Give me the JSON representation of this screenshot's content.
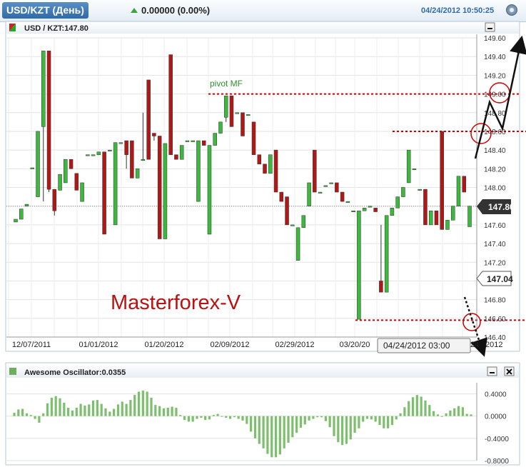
{
  "header": {
    "symbol_label": "USD/KZT (День)",
    "quote": "0.00000 (0.00%)",
    "datetime": "04/24/2012 10:50:25"
  },
  "price_panel": {
    "title": "USD / KZT:147.80",
    "watermark": "Masterforex-V",
    "pivot_label": "pivot MF",
    "last_price": "147.80",
    "marker_price": "147.04",
    "crosshair_label": "04/24/2012 03:00",
    "last_date_fragment": "24",
    "last_date_year": "2012"
  },
  "oscillator_panel": {
    "title": "Awesome Oscillator:0.0355"
  },
  "colors": {
    "bull": "#3cb83c",
    "bear": "#b01818",
    "annotation": "#cc0000",
    "watermark": "#bb1111",
    "oscillator": "#7cbf6c"
  },
  "chart_data": [
    {
      "type": "candlestick",
      "ylim": [
        146.4,
        149.6
      ],
      "y_ticks": [
        "149.60",
        "149.40",
        "149.20",
        "149.00",
        "148.80",
        "148.60",
        "148.40",
        "148.20",
        "148.00",
        "147.80",
        "147.60",
        "147.40",
        "147.20",
        "147.00",
        "146.80",
        "146.60",
        "146.40"
      ],
      "x_tick_labels": [
        "12/07/2011",
        "01/01/2012",
        "01/20/2012",
        "02/09/2012",
        "02/29/2012",
        "03/20/20"
      ],
      "candles": [
        [
          147.63,
          147.66,
          147.63,
          147.66
        ],
        [
          147.66,
          147.77,
          147.66,
          147.77
        ],
        [
          147.8,
          147.82,
          147.8,
          147.82
        ],
        [
          148.2,
          148.21,
          148.2,
          148.21
        ],
        [
          147.9,
          148.6,
          147.9,
          148.6
        ],
        [
          148.65,
          149.46,
          147.85,
          149.46
        ],
        [
          149.46,
          149.46,
          147.95,
          147.98
        ],
        [
          147.98,
          147.98,
          147.7,
          147.75
        ],
        [
          147.97,
          148.14,
          147.97,
          148.14
        ],
        [
          148.05,
          148.3,
          148.05,
          148.3
        ],
        [
          148.3,
          148.2,
          148.2,
          148.2
        ],
        [
          148.15,
          148.12,
          148.05,
          147.97
        ],
        [
          147.85,
          148.05,
          147.85,
          148.05
        ],
        [
          148.35,
          148.35,
          148.35,
          148.35
        ],
        [
          148.35,
          148.35,
          148.35,
          148.35
        ],
        [
          148.35,
          148.38,
          148.35,
          148.38
        ],
        [
          148.38,
          148.38,
          147.5,
          147.5
        ],
        [
          148.4,
          148.4,
          148.4,
          148.4
        ],
        [
          147.6,
          148.48,
          147.6,
          148.48
        ],
        [
          148.48,
          148.48,
          148.48,
          148.48
        ],
        [
          148.5,
          148.35,
          148.2,
          148.35
        ],
        [
          148.5,
          148.5,
          148.1,
          148.1
        ],
        [
          148.1,
          148.2,
          148.1,
          148.2
        ],
        [
          148.3,
          148.8,
          148.3,
          148.3
        ],
        [
          149.15,
          149.15,
          148.3,
          148.3
        ],
        [
          148.58,
          148.58,
          148.5,
          148.55
        ],
        [
          148.55,
          148.55,
          147.45,
          147.45
        ],
        [
          147.45,
          148.47,
          147.45,
          148.47
        ],
        [
          149.42,
          149.42,
          148.35,
          148.35
        ],
        [
          148.35,
          148.35,
          148.3,
          148.3
        ],
        [
          148.3,
          148.45,
          148.3,
          148.45
        ],
        [
          148.5,
          148.5,
          148.5,
          148.5
        ],
        [
          148.5,
          148.5,
          148.5,
          148.5
        ],
        [
          147.85,
          148.5,
          147.85,
          148.5
        ],
        [
          148.5,
          148.5,
          148.45,
          148.45
        ],
        [
          147.5,
          148.45,
          147.5,
          148.45
        ],
        [
          148.45,
          148.58,
          148.45,
          148.58
        ],
        [
          148.58,
          148.7,
          148.58,
          148.7
        ],
        [
          148.75,
          148.98,
          148.7,
          148.98
        ],
        [
          148.98,
          148.98,
          148.65,
          148.65
        ],
        [
          148.8,
          148.8,
          148.8,
          148.8
        ],
        [
          148.8,
          148.8,
          148.55,
          148.55
        ],
        [
          148.78,
          148.78,
          148.78,
          148.78
        ],
        [
          148.7,
          148.7,
          148.35,
          148.35
        ],
        [
          148.35,
          148.35,
          148.25,
          148.25
        ],
        [
          148.25,
          148.25,
          148.15,
          148.15
        ],
        [
          148.15,
          148.35,
          148.15,
          148.35
        ],
        [
          148.4,
          148.4,
          147.95,
          147.95
        ],
        [
          147.95,
          147.95,
          147.85,
          147.85
        ],
        [
          147.9,
          147.9,
          147.6,
          147.6
        ],
        [
          147.6,
          147.6,
          147.6,
          147.6
        ],
        [
          147.22,
          147.57,
          147.22,
          147.57
        ],
        [
          147.57,
          147.7,
          147.57,
          147.7
        ],
        [
          147.8,
          148.05,
          147.8,
          148.05
        ],
        [
          148.4,
          148.4,
          147.95,
          147.95
        ],
        [
          147.95,
          147.95,
          147.95,
          147.95
        ],
        [
          148.02,
          148.02,
          148.02,
          148.02
        ],
        [
          148.05,
          148.05,
          148.05,
          148.05
        ],
        [
          148.05,
          148.05,
          147.95,
          147.95
        ],
        [
          147.95,
          147.95,
          147.85,
          147.85
        ],
        [
          147.85,
          147.85,
          147.85,
          147.85
        ],
        [
          147.75,
          147.75,
          147.75,
          147.75
        ],
        [
          146.59,
          147.75,
          146.59,
          147.75
        ],
        [
          147.75,
          147.78,
          147.75,
          147.78
        ],
        [
          147.8,
          147.8,
          147.8,
          147.8
        ],
        [
          147.78,
          147.78,
          147.74,
          147.74
        ],
        [
          147.0,
          147.6,
          146.88,
          146.88
        ],
        [
          146.88,
          147.7,
          146.88,
          147.7
        ],
        [
          147.7,
          147.78,
          147.7,
          147.78
        ],
        [
          147.78,
          147.9,
          147.78,
          147.9
        ],
        [
          147.9,
          148.0,
          147.9,
          148.0
        ],
        [
          148.05,
          148.4,
          148.05,
          148.4
        ],
        [
          148.2,
          148.2,
          148.2,
          148.2
        ],
        [
          147.98,
          147.98,
          147.98,
          147.98
        ],
        [
          147.98,
          147.98,
          147.6,
          147.6
        ],
        [
          147.6,
          147.75,
          147.6,
          147.75
        ],
        [
          147.75,
          147.75,
          147.6,
          147.6
        ],
        [
          148.6,
          148.6,
          147.55,
          147.55
        ],
        [
          147.55,
          147.65,
          147.55,
          147.65
        ],
        [
          147.65,
          147.8,
          147.65,
          147.8
        ],
        [
          147.8,
          148.12,
          147.8,
          148.12
        ],
        [
          148.12,
          148.12,
          147.95,
          147.95
        ],
        [
          147.58,
          147.8,
          147.58,
          147.8
        ]
      ],
      "annotations": [
        {
          "type": "hline",
          "y": 149.0,
          "style": "dotted",
          "color": "#cc0000",
          "label": "pivot MF"
        },
        {
          "type": "hline",
          "y": 148.6,
          "style": "dotted",
          "color": "#cc0000"
        },
        {
          "type": "hline",
          "y": 146.58,
          "style": "dotted",
          "color": "#cc0000"
        },
        {
          "type": "hline",
          "y": 147.8,
          "style": "dotted",
          "color": "#888888"
        },
        {
          "type": "circle",
          "y": 149.0
        },
        {
          "type": "circle",
          "y": 148.6
        },
        {
          "type": "circle",
          "y": 146.62
        }
      ]
    },
    {
      "type": "bar",
      "title": "Awesome Oscillator:0.0355",
      "ylim": [
        -0.8,
        0.6
      ],
      "y_ticks": [
        "0.4000",
        "0.0000",
        "-0.4000",
        "-0.8000"
      ],
      "values": [
        0.06,
        0.12,
        0.13,
        0.05,
        0.02,
        -0.05,
        -0.12,
        0.05,
        0.23,
        0.33,
        0.36,
        0.32,
        0.24,
        0.15,
        0.1,
        0.15,
        0.22,
        0.19,
        0.21,
        0.28,
        0.29,
        0.22,
        0.14,
        0.08,
        0.13,
        0.21,
        0.26,
        0.22,
        0.29,
        0.38,
        0.44,
        0.46,
        0.44,
        0.33,
        0.2,
        0.18,
        0.14,
        0.15,
        0.17,
        0.15,
        0.02,
        -0.07,
        -0.1,
        -0.1,
        -0.05,
        -0.03,
        -0.07,
        -0.06,
        0.02,
        0.04,
        0.0,
        -0.03,
        -0.05,
        -0.02,
        -0.05,
        -0.08,
        -0.14,
        -0.28,
        -0.4,
        -0.5,
        -0.58,
        -0.68,
        -0.74,
        -0.74,
        -0.69,
        -0.58,
        -0.48,
        -0.38,
        -0.3,
        -0.21,
        -0.15,
        -0.08,
        -0.05,
        -0.02,
        -0.02,
        -0.09,
        -0.2,
        -0.36,
        -0.47,
        -0.52,
        -0.5,
        -0.42,
        -0.3,
        -0.22,
        -0.1,
        -0.05,
        -0.06,
        -0.1,
        -0.16,
        -0.22,
        -0.22,
        -0.16,
        -0.06,
        0.05,
        0.16,
        0.27,
        0.34,
        0.38,
        0.35,
        0.28,
        0.2,
        0.09,
        0.03,
        0.0,
        0.05,
        0.1,
        0.14,
        0.18,
        0.16,
        0.04,
        0.03
      ]
    }
  ]
}
